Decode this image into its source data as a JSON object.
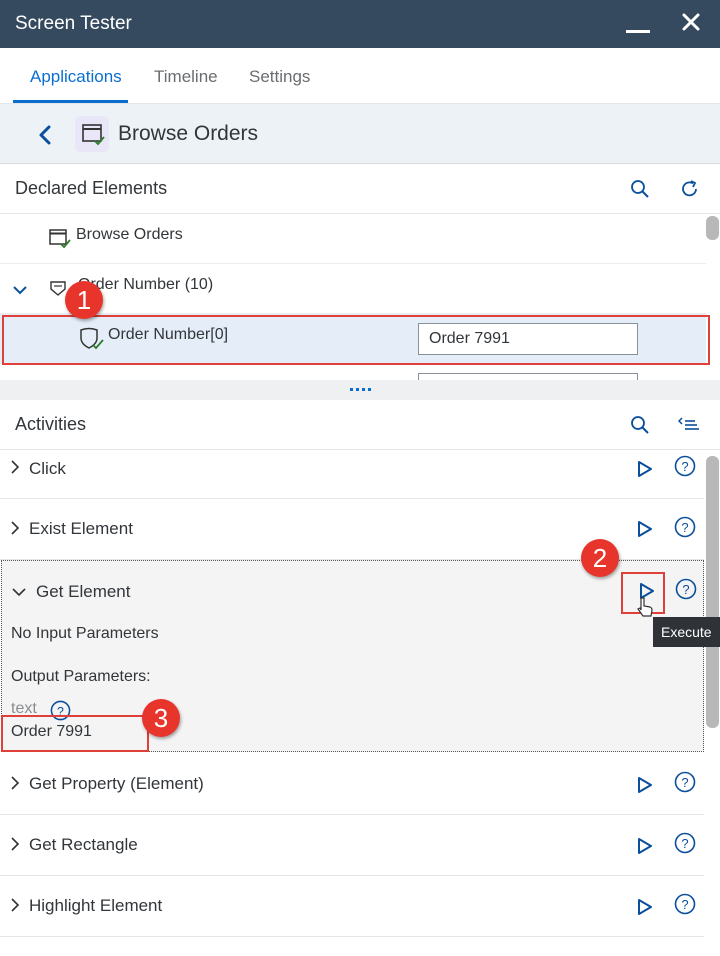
{
  "window": {
    "title": "Screen Tester"
  },
  "tabs": [
    {
      "label": "Applications",
      "active": true
    },
    {
      "label": "Timeline",
      "active": false
    },
    {
      "label": "Settings",
      "active": false
    }
  ],
  "breadcrumb": {
    "title": "Browse Orders",
    "icon": "window-check-icon"
  },
  "declared": {
    "header": "Declared Elements",
    "items": [
      {
        "label": "Browse Orders",
        "icon": "window-check-icon"
      },
      {
        "label": "Order Number (10)",
        "icon": "shield-group-icon"
      },
      {
        "label": "Order Number[0]",
        "icon": "shield-check-icon",
        "value": "Order 7991"
      }
    ]
  },
  "activities": {
    "header": "Activities",
    "items": [
      {
        "label": "Click"
      },
      {
        "label": "Exist Element"
      },
      {
        "label": "Get Element"
      },
      {
        "label": "Get Property (Element)"
      },
      {
        "label": "Get Rectangle"
      },
      {
        "label": "Highlight Element"
      }
    ],
    "expanded": {
      "no_input": "No Input Parameters",
      "output_header": "Output Parameters:",
      "param_name": "text",
      "param_value": "Order 7991"
    }
  },
  "tooltip": {
    "text": "Execute"
  },
  "markers": [
    "1",
    "2",
    "3"
  ],
  "colors": {
    "titlebar": "#354a5f",
    "accent": "#0a6ed1",
    "marker": "#e8352c"
  }
}
